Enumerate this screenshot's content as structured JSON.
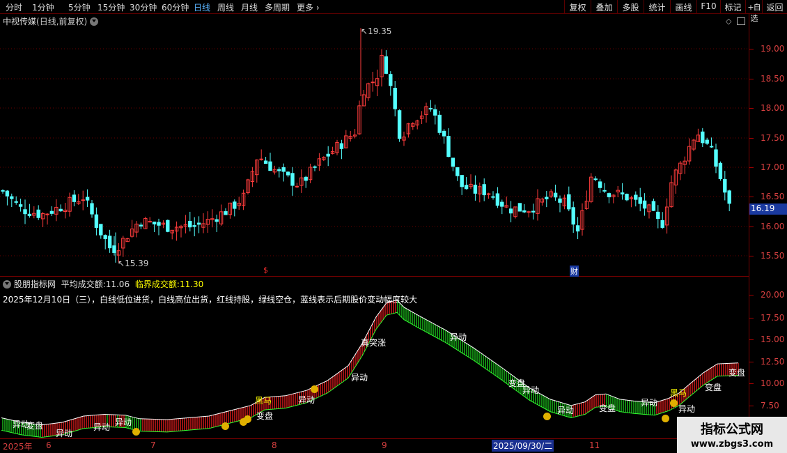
{
  "toolbar": {
    "periods": [
      "分时",
      "1分钟",
      "5分钟",
      "15分钟",
      "30分钟",
      "60分钟",
      "日线",
      "周线",
      "月线",
      "多周期",
      "更多"
    ],
    "active": "日线",
    "more_icon": "chevron-right-icon",
    "buttons": [
      "复权",
      "叠加",
      "多股",
      "统计",
      "画线",
      "F10",
      "标记",
      "+自选",
      "返回"
    ]
  },
  "main_panel": {
    "stock_name": "中视传媒",
    "mode": "(日线,前复权)",
    "settings_icon": "chevron-down-icon",
    "diamond_icon": "diamond-icon",
    "price_axis": [
      "19.00",
      "18.50",
      "18.00",
      "17.50",
      "17.00",
      "16.50",
      "16.00",
      "15.50"
    ],
    "current_price": "16.19",
    "high_label": "19.35",
    "low_label": "15.39",
    "marker_dollar": "$",
    "marker_cai": "财"
  },
  "indicator_panel": {
    "name": "股朋指标网",
    "avg_label": "平均成交额:",
    "avg_value": "11.06",
    "crit_label": "临界成交额:",
    "crit_value": "11.30",
    "description": "2025年12月10日（三），白线低位进货，白线高位出货，红线持股，绿线空仓，蓝线表示后期股价变动幅度较大",
    "axis": [
      "20.00",
      "17.50",
      "15.00",
      "12.50",
      "10.00",
      "7.50"
    ],
    "labels": [
      {
        "t": "异动",
        "c": "#ffffff"
      },
      {
        "t": "变盘",
        "c": "#ffffff"
      },
      {
        "t": "异动",
        "c": "#ffffff"
      },
      {
        "t": "异动",
        "c": "#ffffff"
      },
      {
        "t": "异动",
        "c": "#ffffff"
      },
      {
        "t": "黑马",
        "c": "#ffff00"
      },
      {
        "t": "变盘",
        "c": "#ffffff"
      },
      {
        "t": "异动",
        "c": "#ffffff"
      },
      {
        "t": "真突涨",
        "c": "#ffffff"
      },
      {
        "t": "异动",
        "c": "#ffffff"
      },
      {
        "t": "异动",
        "c": "#ffffff"
      },
      {
        "t": "变盘",
        "c": "#ffffff"
      },
      {
        "t": "异动",
        "c": "#ffffff"
      },
      {
        "t": "异动",
        "c": "#ffffff"
      },
      {
        "t": "变盘",
        "c": "#ffffff"
      },
      {
        "t": "异动",
        "c": "#ffffff"
      },
      {
        "t": "黑马",
        "c": "#ffff00"
      },
      {
        "t": "异动",
        "c": "#ffffff"
      },
      {
        "t": "变盘",
        "c": "#ffffff"
      },
      {
        "t": "变盘",
        "c": "#ffffff"
      }
    ]
  },
  "date_axis": {
    "items": [
      "2025年",
      "6",
      "7",
      "8",
      "9",
      "2025/09/30/二",
      "11"
    ]
  },
  "watermark": {
    "title": "指标公式网",
    "url": "www.zbgs3.com"
  },
  "colors": {
    "up": "#ff3c3c",
    "down": "#54ffff",
    "grid": "#7a0000",
    "axis_text": "#d84040",
    "active_tab": "#5ab4ff",
    "yellow": "#ffff00"
  }
}
